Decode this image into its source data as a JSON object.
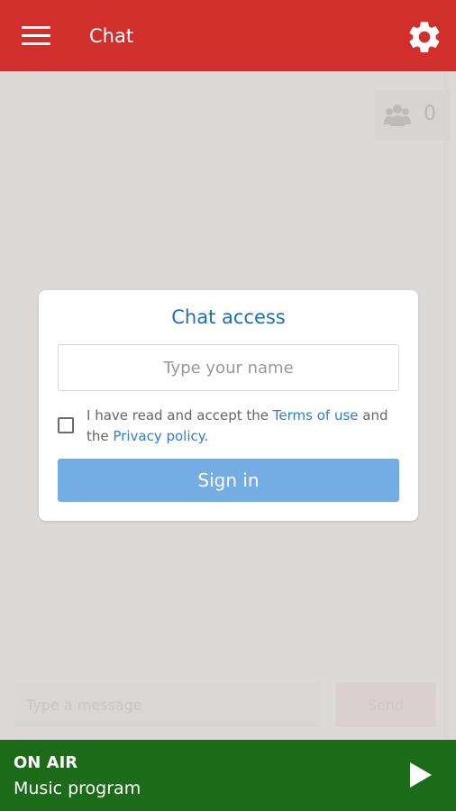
{
  "app_bar": {
    "title": "Chat",
    "menu_icon": "hamburger-menu-icon",
    "settings_icon": "gear-icon",
    "color": "#d12f2b"
  },
  "users": {
    "icon": "users-group-icon",
    "count": "0"
  },
  "chat_access": {
    "title": "Chat access",
    "name_placeholder": "Type your name",
    "consent_prefix": "I have read and accept the ",
    "terms_link": "Terms of use",
    "consent_middle": " and the ",
    "privacy_link": "Privacy policy",
    "consent_suffix": ".",
    "checkbox_checked": false,
    "sign_in_label": "Sign in"
  },
  "composer": {
    "message_placeholder": "Type a message",
    "send_label": "Send"
  },
  "player": {
    "status": "ON AIR",
    "program": "Music program",
    "play_icon": "play-icon",
    "color": "#1c6b18"
  }
}
